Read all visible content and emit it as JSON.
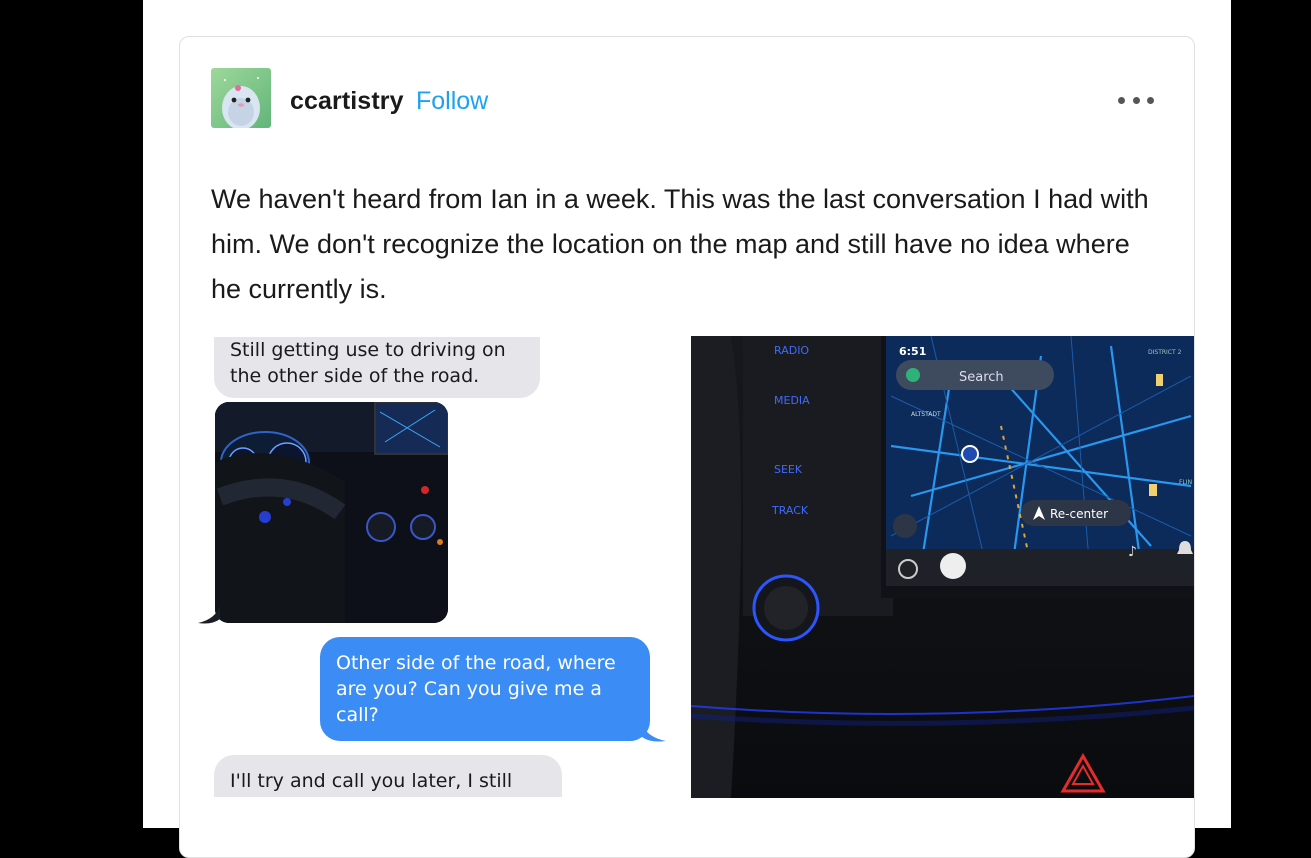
{
  "post": {
    "username": "ccartistry",
    "follow_label": "Follow",
    "more_icon": "ellipsis-icon",
    "text": "We haven't heard from Ian in a week. This was the last conversation I had with him. We don't recognize the location on the map and still have no idea where he currently is."
  },
  "messages": [
    {
      "from": "them",
      "text_line1": "Still getting use to driving on",
      "text_line2": "the other side of the road."
    },
    {
      "from": "me",
      "text_line1": "Other side of the road, where",
      "text_line2": "are you? Can you give me a",
      "text_line3": "call?"
    },
    {
      "from": "them",
      "text_line1": "I'll try and call you later, I still"
    }
  ],
  "car_screen": {
    "buttons": [
      "RADIO",
      "MEDIA",
      "SEEK",
      "TRACK"
    ],
    "time": "6:51",
    "search_placeholder": "Search",
    "recenter_label": "Re-center",
    "district_label": "DISTRICT 2",
    "altstadt_label": "ALTSTADT",
    "edge_label": "FLIN"
  },
  "colors": {
    "follow": "#1da1f2",
    "bubble_blue": "#3b8df5",
    "bubble_gray": "#e5e5ea",
    "map_bg": "#0c2a5a"
  }
}
